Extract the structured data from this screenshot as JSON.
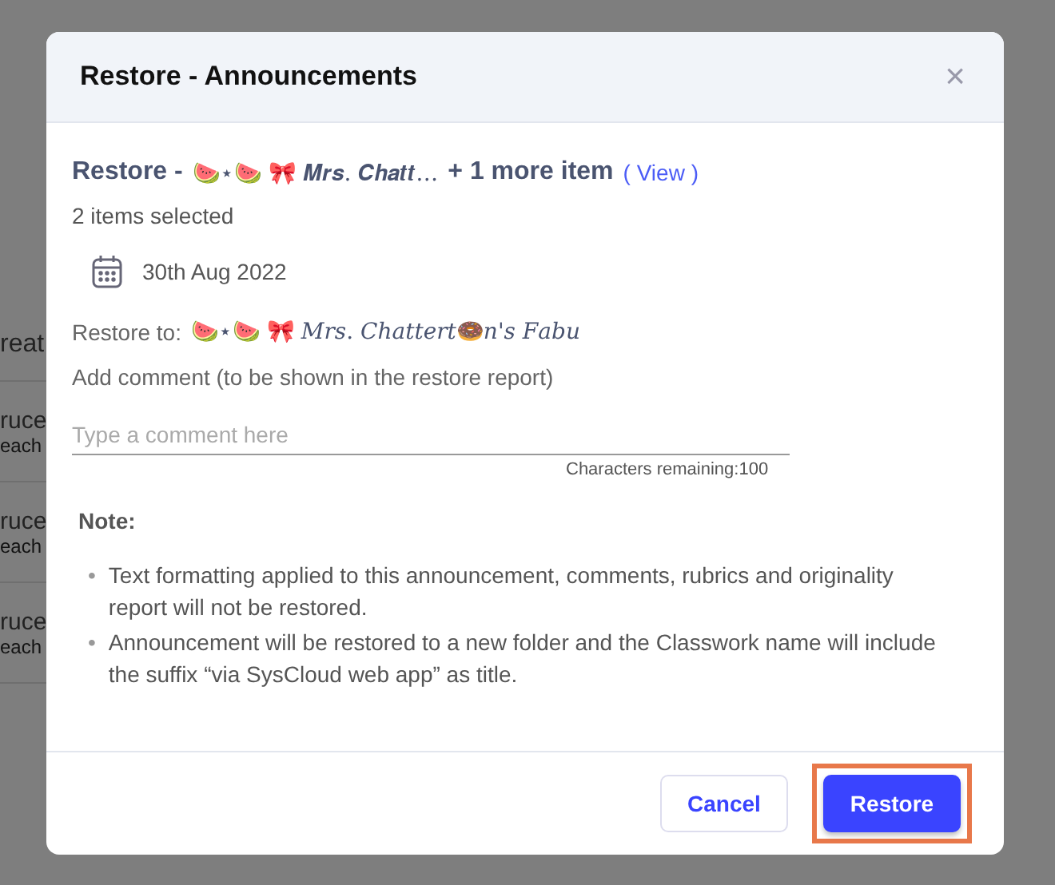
{
  "background": {
    "column_header": "reat",
    "rows": [
      {
        "name": "ruce",
        "role": "each"
      },
      {
        "name": "ruce",
        "role": "each"
      },
      {
        "name": "ruce",
        "role": "each"
      }
    ]
  },
  "dialog": {
    "title": "Restore - Announcements",
    "close": "×",
    "heading": {
      "prefix": "Restore - ",
      "item": "🍉⋆🍉 🎀 𝑴𝒓𝒔. 𝑪𝒉𝒂𝒕𝒕…",
      "more": "+ 1 more item",
      "link": "( View )"
    },
    "selection_count": "2 items selected",
    "date": "30th Aug 2022",
    "restore_to": {
      "label": "Restore to:",
      "value": "🍉⋆🍉 🎀 𝑀𝑟𝑠. 𝐶ℎ𝑎𝑡𝑡𝑒𝑟𝑡🍩𝑛'𝑠 𝐹𝑎𝑏𝑢"
    },
    "comment": {
      "label": "Add comment (to be shown in the restore report)",
      "placeholder": "Type a comment here",
      "counter": "Characters remaining:100"
    },
    "note": {
      "title": "Note:",
      "items": [
        {
          "marker": "•",
          "text": "Text formatting applied to this announcement, comments, rubrics and originality report will not be restored."
        },
        {
          "marker": "•",
          "text": "Announcement will be restored to a new folder and the Classwork name will include the suffix “via SysCloud web app” as title."
        }
      ]
    },
    "buttons": [
      {
        "label": "Cancel",
        "kind": "secondary",
        "highlighted": false
      },
      {
        "label": "Restore",
        "kind": "primary",
        "highlighted": true
      }
    ]
  }
}
